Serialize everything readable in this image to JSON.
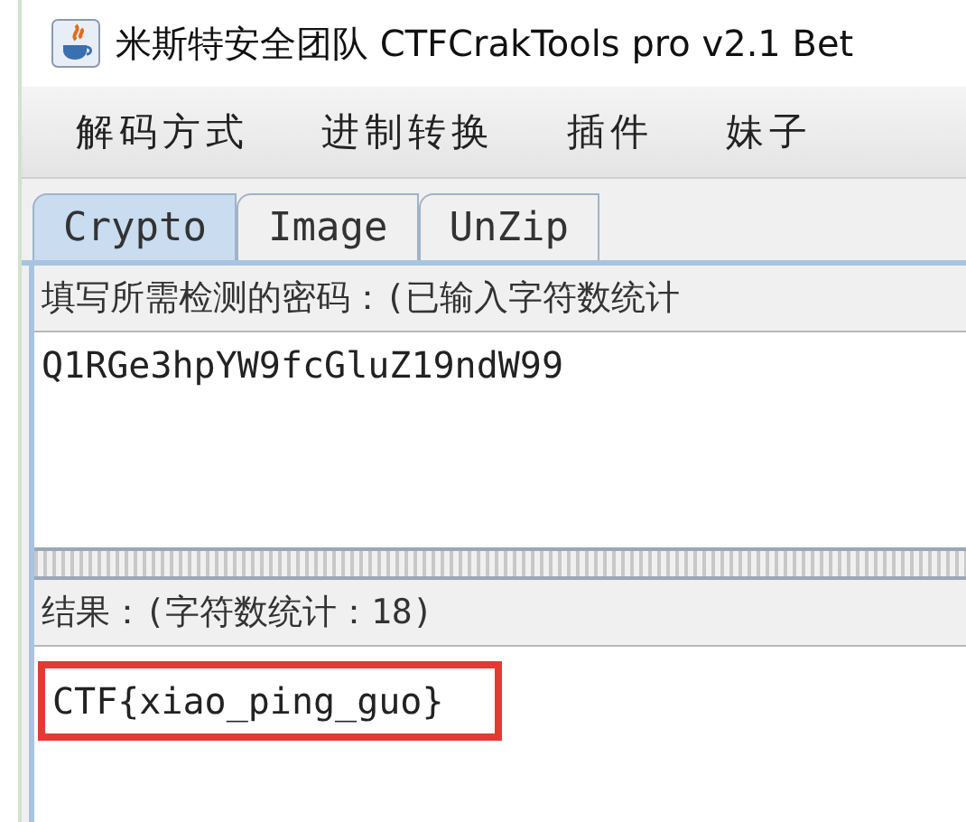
{
  "window": {
    "title": "米斯特安全团队 CTFCrakTools pro v2.1 Bet"
  },
  "menu": [
    "解码方式",
    "进制转换",
    "插件",
    "妹子"
  ],
  "tabs": [
    {
      "label": "Crypto",
      "selected": true
    },
    {
      "label": "Image",
      "selected": false
    },
    {
      "label": "UnZip",
      "selected": false
    }
  ],
  "input": {
    "label": "填写所需检测的密码：(已输入字符数统计",
    "value": "Q1RGe3hpYW9fcGluZ19ndW99"
  },
  "result": {
    "label": "结果：(字符数统计：18)",
    "value": "CTF{xiao_ping_guo}",
    "highlighted": true
  }
}
